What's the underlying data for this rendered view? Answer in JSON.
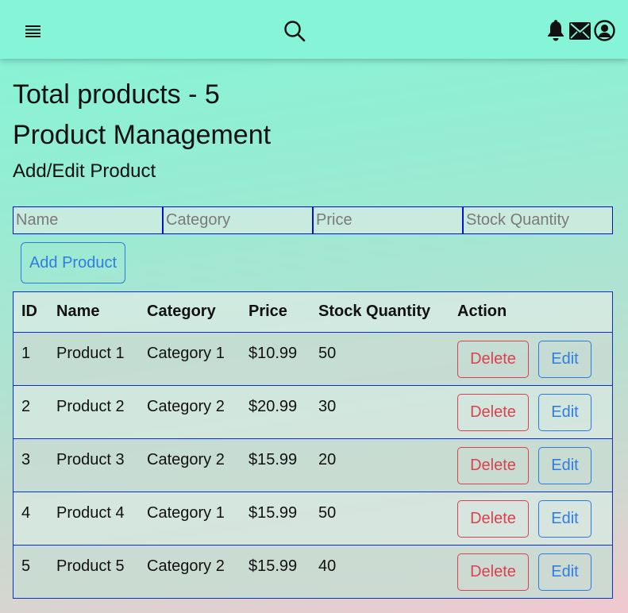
{
  "header": {
    "menu_icon": "hamburger-menu-icon",
    "search_icon": "search-icon",
    "right_icons": [
      "bell-icon",
      "envelope-icon",
      "user-circle-icon"
    ]
  },
  "summary": {
    "total_text": "Total products - 5"
  },
  "page": {
    "title": "Product Management",
    "form_title": "Add/Edit Product"
  },
  "form": {
    "name_placeholder": "Name",
    "category_placeholder": "Category",
    "price_placeholder": "Price",
    "stock_placeholder": "Stock Quantity",
    "add_label": "Add Product"
  },
  "table": {
    "columns": [
      "ID",
      "Name",
      "Category",
      "Price",
      "Stock Quantity",
      "Action"
    ],
    "rows": [
      {
        "id": "1",
        "name": "Product 1",
        "category": "Category 1",
        "price": "$10.99",
        "stock": "50"
      },
      {
        "id": "2",
        "name": "Product 2",
        "category": "Category 2",
        "price": "$20.99",
        "stock": "30"
      },
      {
        "id": "3",
        "name": "Product 3",
        "category": "Category 2",
        "price": "$15.99",
        "stock": "20"
      },
      {
        "id": "4",
        "name": "Product 4",
        "category": "Category 1",
        "price": "$15.99",
        "stock": "50"
      },
      {
        "id": "5",
        "name": "Product 5",
        "category": "Category 2",
        "price": "$15.99",
        "stock": "40"
      }
    ],
    "delete_label": "Delete",
    "edit_label": "Edit"
  },
  "colors": {
    "header_bg": "#86f5d7",
    "accent_blue": "#2f7de1",
    "danger_red": "#d9414f",
    "border_blue": "#0a2fd6"
  }
}
